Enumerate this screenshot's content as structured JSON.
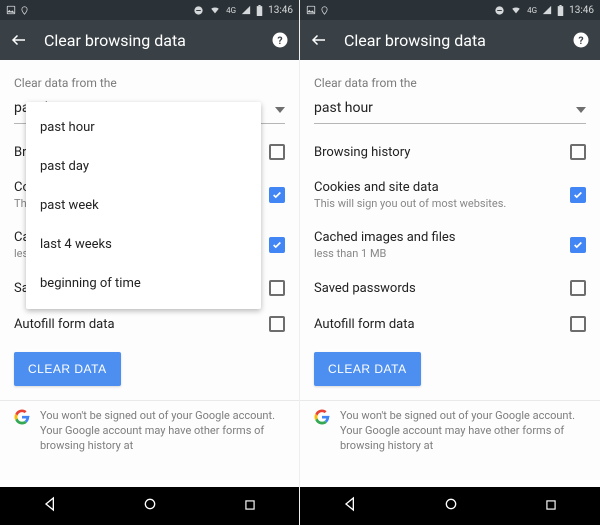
{
  "statusbar": {
    "time": "13:46",
    "net_label": "4G"
  },
  "header": {
    "title": "Clear browsing data"
  },
  "section_label": "Clear data from the",
  "dropdown": {
    "selected": "past hour",
    "options": [
      "past hour",
      "past day",
      "past week",
      "last 4 weeks",
      "beginning of time"
    ]
  },
  "items": [
    {
      "label": "Browsing history",
      "sub": "",
      "checked": false
    },
    {
      "label": "Cookies and site data",
      "sub": "This will sign you out of most websites.",
      "checked": true
    },
    {
      "label": "Cached images and files",
      "sub": "less than 1 MB",
      "checked": true
    },
    {
      "label": "Saved passwords",
      "sub": "",
      "checked": false
    },
    {
      "label": "Autofill form data",
      "sub": "",
      "checked": false
    }
  ],
  "button": {
    "label": "CLEAR DATA"
  },
  "note": "You won't be signed out of your Google account. Your Google account may have other forms of browsing history at"
}
